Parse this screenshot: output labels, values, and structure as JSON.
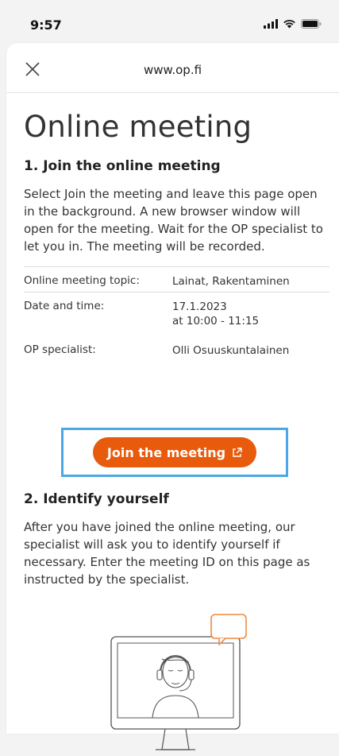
{
  "status": {
    "time": "9:57"
  },
  "header": {
    "url": "www.op.fi"
  },
  "page": {
    "title": "Online meeting",
    "section1_title": "1. Join the online meeting",
    "section1_text": "Select Join the meeting and leave this page open in the background. A new browser window will open for the meeting. Wait for the OP specialist to let you in. The meeting will be recorded.",
    "info": [
      {
        "label": "Online meeting topic:",
        "value": "Lainat, Rakentaminen"
      },
      {
        "label": "Date and time:",
        "value": "17.1.2023",
        "value2": "at 10:00 - 11:15"
      },
      {
        "label": "OP specialist:",
        "value": "Olli Osuuskuntalainen"
      }
    ],
    "join_button_label": "Join the meeting",
    "section2_title": "2. Identify yourself",
    "section2_text": "After you have joined the online meeting, our specialist will ask you to identify yourself if necessary. Enter the meeting ID on this page as instructed by the specialist."
  },
  "colors": {
    "accent": "#e85a0c",
    "highlight_frame": "#4aa8e6",
    "illustration_bubble": "#f08a3c"
  },
  "icons": {
    "close": "close-icon",
    "external": "external-link-icon",
    "signal": "cellular-signal-icon",
    "wifi": "wifi-icon",
    "battery": "battery-icon"
  }
}
